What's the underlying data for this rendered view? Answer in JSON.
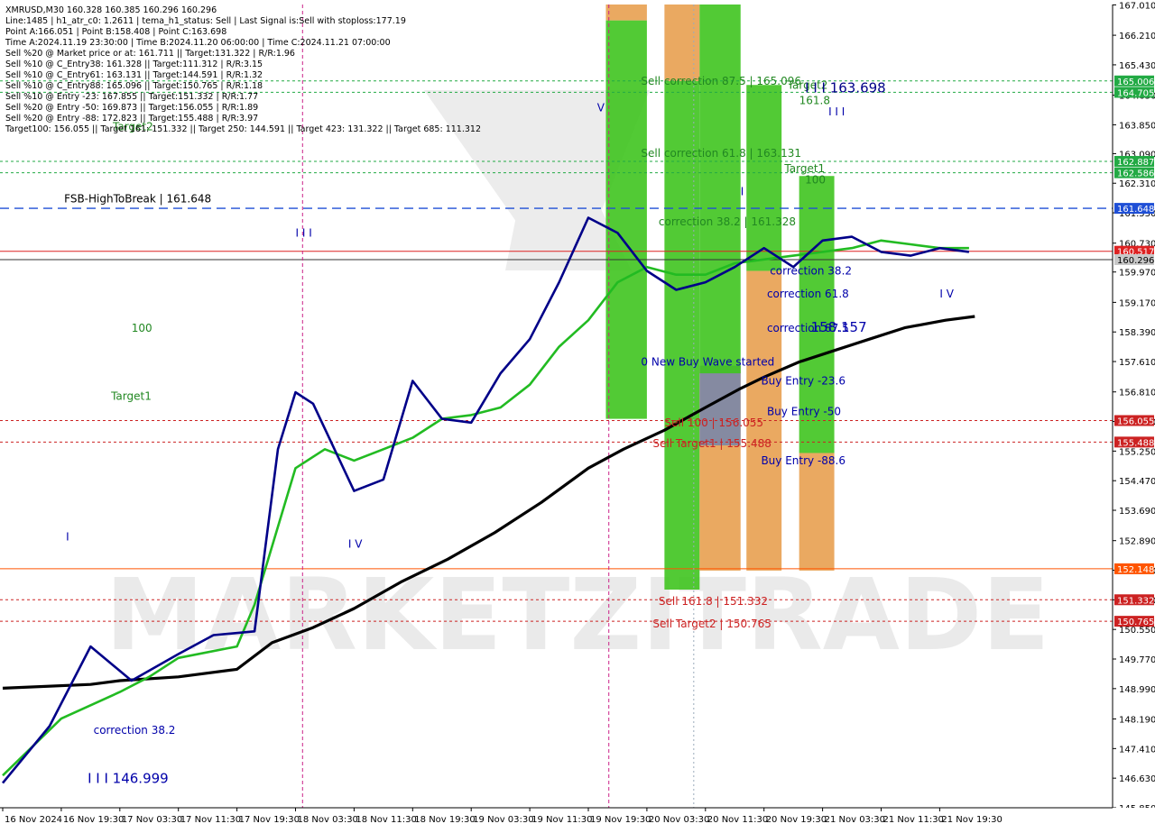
{
  "header": {
    "lines": [
      "XMRUSD,M30  160.328 160.385 160.296 160.296",
      "Line:1485 | h1_atr_c0: 1.2611 | tema_h1_status: Sell | Last Signal is:Sell with stoploss:177.19",
      "Point A:166.051 | Point B:158.408 | Point C:163.698",
      "Time A:2024.11.19 23:30:00 | Time B:2024.11.20 06:00:00 | Time C:2024.11.21 07:00:00",
      "Sell %20 @ Market price or at: 161.711 || Target:131.322 | R/R:1.96",
      "Sell %10 @ C_Entry38: 161.328 || Target:111.312 | R/R:3.15",
      "Sell %10 @ C_Entry61: 163.131 || Target:144.591 | R/R:1.32",
      "Sell %10 @ C_Entry88: 165.096 || Target:150.765 | R/R:1.18",
      "Sell %10 @ Entry -23: 167.855 || Target:151.332 | R/R:1.77",
      "Sell %20 @ Entry -50: 169.873 || Target:156.055 | R/R:1.89",
      "Sell %20 @ Entry -88: 172.823 || Target:155.488 | R/R:3.97",
      "Target100: 156.055 || Target 161: 151.332 || Target 250: 144.591 || Target 423: 131.322 || Target 685: 111.312"
    ]
  },
  "watermark": {
    "text": "MARKETZITRADE",
    "color": "#d9d9d9"
  },
  "chart_data": {
    "type": "line",
    "title": "XMRUSD,M30",
    "ylim": [
      145.85,
      167.02
    ],
    "x_tick_labels": [
      "16 Nov 2024",
      "16 Nov 19:30",
      "17 Nov 03:30",
      "17 Nov 11:30",
      "17 Nov 19:30",
      "18 Nov 03:30",
      "18 Nov 11:30",
      "18 Nov 19:30",
      "19 Nov 03:30",
      "19 Nov 11:30",
      "19 Nov 19:30",
      "20 Nov 03:30",
      "20 Nov 11:30",
      "20 Nov 19:30",
      "21 Nov 03:30",
      "21 Nov 11:30",
      "21 Nov 19:30"
    ],
    "y_tick_labels": [
      "167.010",
      "166.210",
      "165.430",
      "164.630",
      "163.850",
      "163.090",
      "162.310",
      "161.530",
      "160.730",
      "159.970",
      "159.170",
      "158.390",
      "157.610",
      "156.810",
      "156.030",
      "155.250",
      "154.470",
      "153.690",
      "152.890",
      "152.110",
      "151.330",
      "150.550",
      "149.770",
      "148.990",
      "148.190",
      "147.410",
      "146.630",
      "145.850"
    ],
    "series": [
      {
        "name": "",
        "color": "#000000",
        "x": [
          0,
          1.5,
          2,
          3,
          4,
          4.6,
          5.3,
          6,
          6.8,
          7.6,
          8.4,
          9.2,
          10,
          10.6,
          11.3,
          12,
          12.6,
          13,
          13.6,
          14.2,
          14.8,
          15.4,
          16.1,
          16.6
        ],
        "y": [
          149.0,
          149.1,
          149.2,
          149.3,
          149.5,
          150.2,
          150.6,
          151.1,
          151.8,
          152.4,
          153.1,
          153.9,
          154.8,
          155.3,
          155.8,
          156.4,
          156.9,
          157.2,
          157.6,
          157.9,
          158.2,
          158.5,
          158.7,
          158.8
        ]
      },
      {
        "name": "",
        "color": "#22bb22",
        "x": [
          0,
          1,
          2,
          2.5,
          3,
          4,
          4.3,
          5,
          5.5,
          6,
          6.5,
          7,
          7.5,
          8,
          8.5,
          9,
          9.5,
          10,
          10.5,
          11,
          11.5,
          12,
          12.5,
          13,
          13.5,
          14,
          14.5,
          15,
          15.5,
          16,
          16.5
        ],
        "y": [
          146.7,
          148.2,
          148.9,
          149.3,
          149.8,
          150.1,
          151.2,
          154.8,
          155.3,
          155.0,
          155.3,
          155.6,
          156.1,
          156.2,
          156.4,
          157.0,
          158.0,
          158.7,
          159.7,
          160.1,
          159.9,
          159.9,
          160.2,
          160.3,
          160.4,
          160.5,
          160.6,
          160.8,
          160.7,
          160.6,
          160.6
        ]
      },
      {
        "name": "",
        "color": "#000088",
        "x": [
          0,
          0.8,
          1.5,
          2.2,
          3,
          3.6,
          4.3,
          4.7,
          5,
          5.3,
          6,
          6.5,
          7,
          7.5,
          8,
          8.5,
          9,
          9.5,
          10,
          10.5,
          11,
          11.5,
          12,
          12.5,
          13,
          13.5,
          14,
          14.5,
          15,
          15.5,
          16,
          16.5
        ],
        "y": [
          146.5,
          148.0,
          150.1,
          149.2,
          149.9,
          150.4,
          150.5,
          155.3,
          156.8,
          156.5,
          154.2,
          154.5,
          157.1,
          156.1,
          156.0,
          157.3,
          158.2,
          159.7,
          161.4,
          161.0,
          160.0,
          159.5,
          159.7,
          160.1,
          160.6,
          160.1,
          160.8,
          160.9,
          160.5,
          160.4,
          160.6,
          160.5
        ]
      }
    ],
    "levels": [
      {
        "label": "165.006",
        "value": 165.006,
        "color": "#22aa44",
        "style": "dotted"
      },
      {
        "label": "164.705",
        "value": 164.705,
        "color": "#22aa44",
        "style": "dotted"
      },
      {
        "label": "162.887",
        "value": 162.887,
        "color": "#22aa44",
        "style": "dotted"
      },
      {
        "label": "162.586",
        "value": 162.586,
        "color": "#22aa44",
        "style": "dotted"
      },
      {
        "label": "161.648",
        "value": 161.648,
        "color": "#1f4fd6",
        "style": "dashed"
      },
      {
        "label": "160.517",
        "value": 160.517,
        "color": "#dd2222",
        "style": "solid"
      },
      {
        "label": "160.296",
        "value": 160.296,
        "color": "#333333",
        "style": "price"
      },
      {
        "label": "156.055",
        "value": 156.055,
        "color": "#cc2222",
        "style": "dotted"
      },
      {
        "label": "155.488",
        "value": 155.488,
        "color": "#cc2222",
        "style": "dotted"
      },
      {
        "label": "152.148",
        "value": 152.148,
        "color": "#ff5500",
        "style": "solid"
      },
      {
        "label": "151.332",
        "value": 151.332,
        "color": "#cc2222",
        "style": "dotted"
      },
      {
        "label": "150.765",
        "value": 150.765,
        "color": "#cc2222",
        "style": "dotted"
      }
    ],
    "zones": [
      {
        "color": "#e8a050",
        "x0": 10.3,
        "x1": 11.0,
        "y0": 166.6,
        "y1": 167.02
      },
      {
        "color": "#3fc41f",
        "x0": 10.3,
        "x1": 11.0,
        "y0": 156.1,
        "y1": 166.6
      },
      {
        "color": "#e8a050",
        "x0": 11.3,
        "x1": 11.9,
        "y0": 165.0,
        "y1": 167.02
      },
      {
        "color": "#3fc41f",
        "x0": 11.3,
        "x1": 11.9,
        "y0": 151.6,
        "y1": 165.0
      },
      {
        "color": "#e8a050",
        "x0": 11.9,
        "x1": 12.6,
        "y0": 152.1,
        "y1": 157.5
      },
      {
        "color": "#7a86a8",
        "x0": 11.9,
        "x1": 12.6,
        "y0": 155.4,
        "y1": 157.5
      },
      {
        "color": "#3fc41f",
        "x0": 11.9,
        "x1": 12.6,
        "y0": 157.3,
        "y1": 167.02
      },
      {
        "color": "#e8a050",
        "x0": 12.7,
        "x1": 13.3,
        "y0": 152.1,
        "y1": 160.0
      },
      {
        "color": "#3fc41f",
        "x0": 12.7,
        "x1": 13.3,
        "y0": 160.0,
        "y1": 164.9
      },
      {
        "color": "#e8a050",
        "x0": 13.6,
        "x1": 14.2,
        "y0": 152.1,
        "y1": 155.2
      },
      {
        "color": "#3fc41f",
        "x0": 13.6,
        "x1": 14.2,
        "y0": 155.2,
        "y1": 162.5
      }
    ],
    "annotations": [
      {
        "text": "Target2",
        "x": 1.88,
        "y": 163.7,
        "color": "#228822"
      },
      {
        "text": "FSB-HighToBreak | 161.648",
        "x": 1.05,
        "y": 161.8,
        "color": "#000000"
      },
      {
        "text": "100",
        "x": 2.2,
        "y": 158.4,
        "color": "#228822"
      },
      {
        "text": "Target1",
        "x": 1.85,
        "y": 156.6,
        "color": "#228822"
      },
      {
        "text": "correction 38.2",
        "x": 1.55,
        "y": 147.8,
        "color": "#0000aa"
      },
      {
        "text": "I I I 146.999",
        "x": 1.45,
        "y": 146.5,
        "color": "#0000aa"
      },
      {
        "text": "I",
        "x": 1.08,
        "y": 152.9,
        "color": "#0000aa"
      },
      {
        "text": "I I I",
        "x": 5.0,
        "y": 160.9,
        "color": "#0000aa"
      },
      {
        "text": "I V",
        "x": 5.9,
        "y": 152.7,
        "color": "#0000aa"
      },
      {
        "text": "V",
        "x": 10.15,
        "y": 164.2,
        "color": "#0000aa"
      },
      {
        "text": "Sell correction 87.5 | 165.096",
        "x": 10.9,
        "y": 164.9,
        "color": "#228822"
      },
      {
        "text": "Target2",
        "x": 13.4,
        "y": 164.8,
        "color": "#228822"
      },
      {
        "text": "I I I 163.698",
        "x": 13.7,
        "y": 164.7,
        "color": "#000088"
      },
      {
        "text": "161.8",
        "x": 13.6,
        "y": 164.4,
        "color": "#228822"
      },
      {
        "text": "I I I",
        "x": 14.1,
        "y": 164.1,
        "color": "#0000aa"
      },
      {
        "text": "Sell correction 61.8 | 163.131",
        "x": 10.9,
        "y": 163.0,
        "color": "#228822"
      },
      {
        "text": "Target1",
        "x": 13.35,
        "y": 162.6,
        "color": "#228822"
      },
      {
        "text": "100",
        "x": 13.7,
        "y": 162.3,
        "color": "#228822"
      },
      {
        "text": "I",
        "x": 12.6,
        "y": 162.0,
        "color": "#0000aa"
      },
      {
        "text": "correction 38.2 | 161.328",
        "x": 11.2,
        "y": 161.2,
        "color": "#228822"
      },
      {
        "text": "correction 38.2",
        "x": 13.1,
        "y": 159.9,
        "color": "#0000aa"
      },
      {
        "text": "correction 61.8",
        "x": 13.05,
        "y": 159.3,
        "color": "#0000aa"
      },
      {
        "text": "correction 87.5",
        "x": 13.05,
        "y": 158.4,
        "color": "#0000aa"
      },
      {
        "text": "158.157",
        "x": 13.8,
        "y": 158.4,
        "color": "#0000aa"
      },
      {
        "text": "0 New Buy Wave started",
        "x": 10.9,
        "y": 157.5,
        "color": "#0000aa"
      },
      {
        "text": "Buy Entry -23.6",
        "x": 12.95,
        "y": 157.0,
        "color": "#0000aa"
      },
      {
        "text": "Buy Entry -50",
        "x": 13.05,
        "y": 156.2,
        "color": "#0000aa"
      },
      {
        "text": "Buy Entry -88.6",
        "x": 12.95,
        "y": 154.9,
        "color": "#0000aa"
      },
      {
        "text": "Sell 100 | 156.055",
        "x": 11.3,
        "y": 155.9,
        "color": "#cc2222"
      },
      {
        "text": "Sell Target1 | 155.488",
        "x": 11.1,
        "y": 155.35,
        "color": "#cc2222"
      },
      {
        "text": "Sell 161.8 | 151.332",
        "x": 11.2,
        "y": 151.2,
        "color": "#cc2222"
      },
      {
        "text": "Sell Target2 | 150.765",
        "x": 11.1,
        "y": 150.6,
        "color": "#cc2222"
      },
      {
        "text": "I V",
        "x": 16.0,
        "y": 159.3,
        "color": "#0000aa"
      }
    ],
    "grid": false
  }
}
